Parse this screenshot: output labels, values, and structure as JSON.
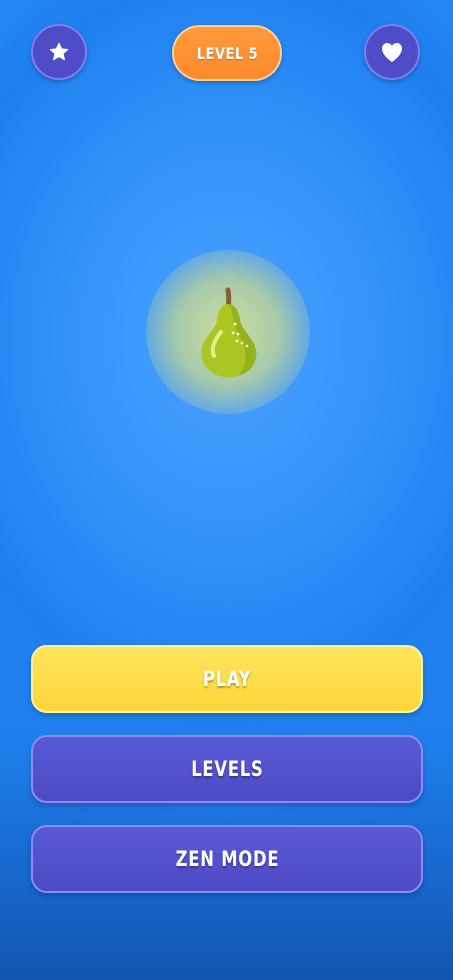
{
  "header": {
    "left_icon": "star-icon",
    "right_icon": "heart-icon",
    "level_label": "LEVEL 5"
  },
  "main": {
    "fruit_icon": "pear-icon"
  },
  "menu": {
    "play_label": "PLAY",
    "levels_label": "LEVELS",
    "zen_label": "ZEN MODE"
  },
  "colors": {
    "background": "#2a8ff8",
    "level_pill": "#fb8a2a",
    "play_button": "#ffd63a",
    "secondary_button": "#4d49c4",
    "circle_button": "#4f4cc8"
  }
}
